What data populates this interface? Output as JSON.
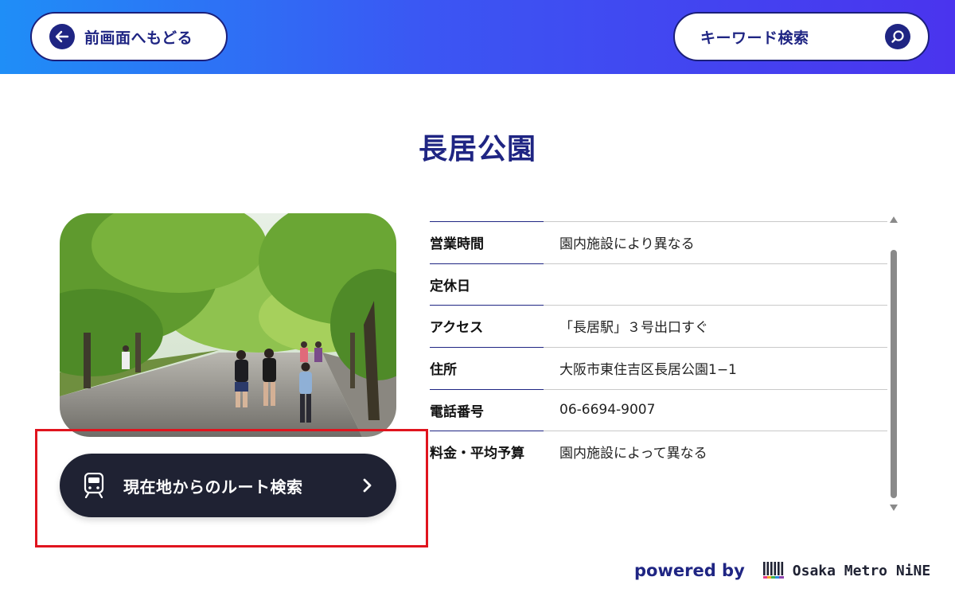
{
  "header": {
    "back_label": "前画面へもどる",
    "search_label": "キーワード検索"
  },
  "page": {
    "title": "長居公園"
  },
  "photo": {
    "description_icon": "park-photo"
  },
  "route_button": {
    "label": "現在地からのルート検索",
    "icon": "train-icon"
  },
  "info": {
    "rows": [
      {
        "key": "営業時間",
        "value": "園内施設により異なる"
      },
      {
        "key": "定休日",
        "value": ""
      },
      {
        "key": "アクセス",
        "value": "「長居駅」３号出口すぐ"
      },
      {
        "key": "住所",
        "value": "大阪市東住吉区長居公園1−1"
      },
      {
        "key": "電話番号",
        "value": "06-6694-9007"
      },
      {
        "key": "料金・平均予算",
        "value": "園内施設によって異なる"
      }
    ]
  },
  "footer": {
    "powered_by": "powered by",
    "brand": "Osaka Metro NiNE"
  },
  "colors": {
    "navy": "#1f2583",
    "header_gradient_start": "#1f8ef7",
    "header_gradient_end": "#4a34ee",
    "route_button_bg": "#1f2233",
    "highlight_red": "#e0141e"
  }
}
